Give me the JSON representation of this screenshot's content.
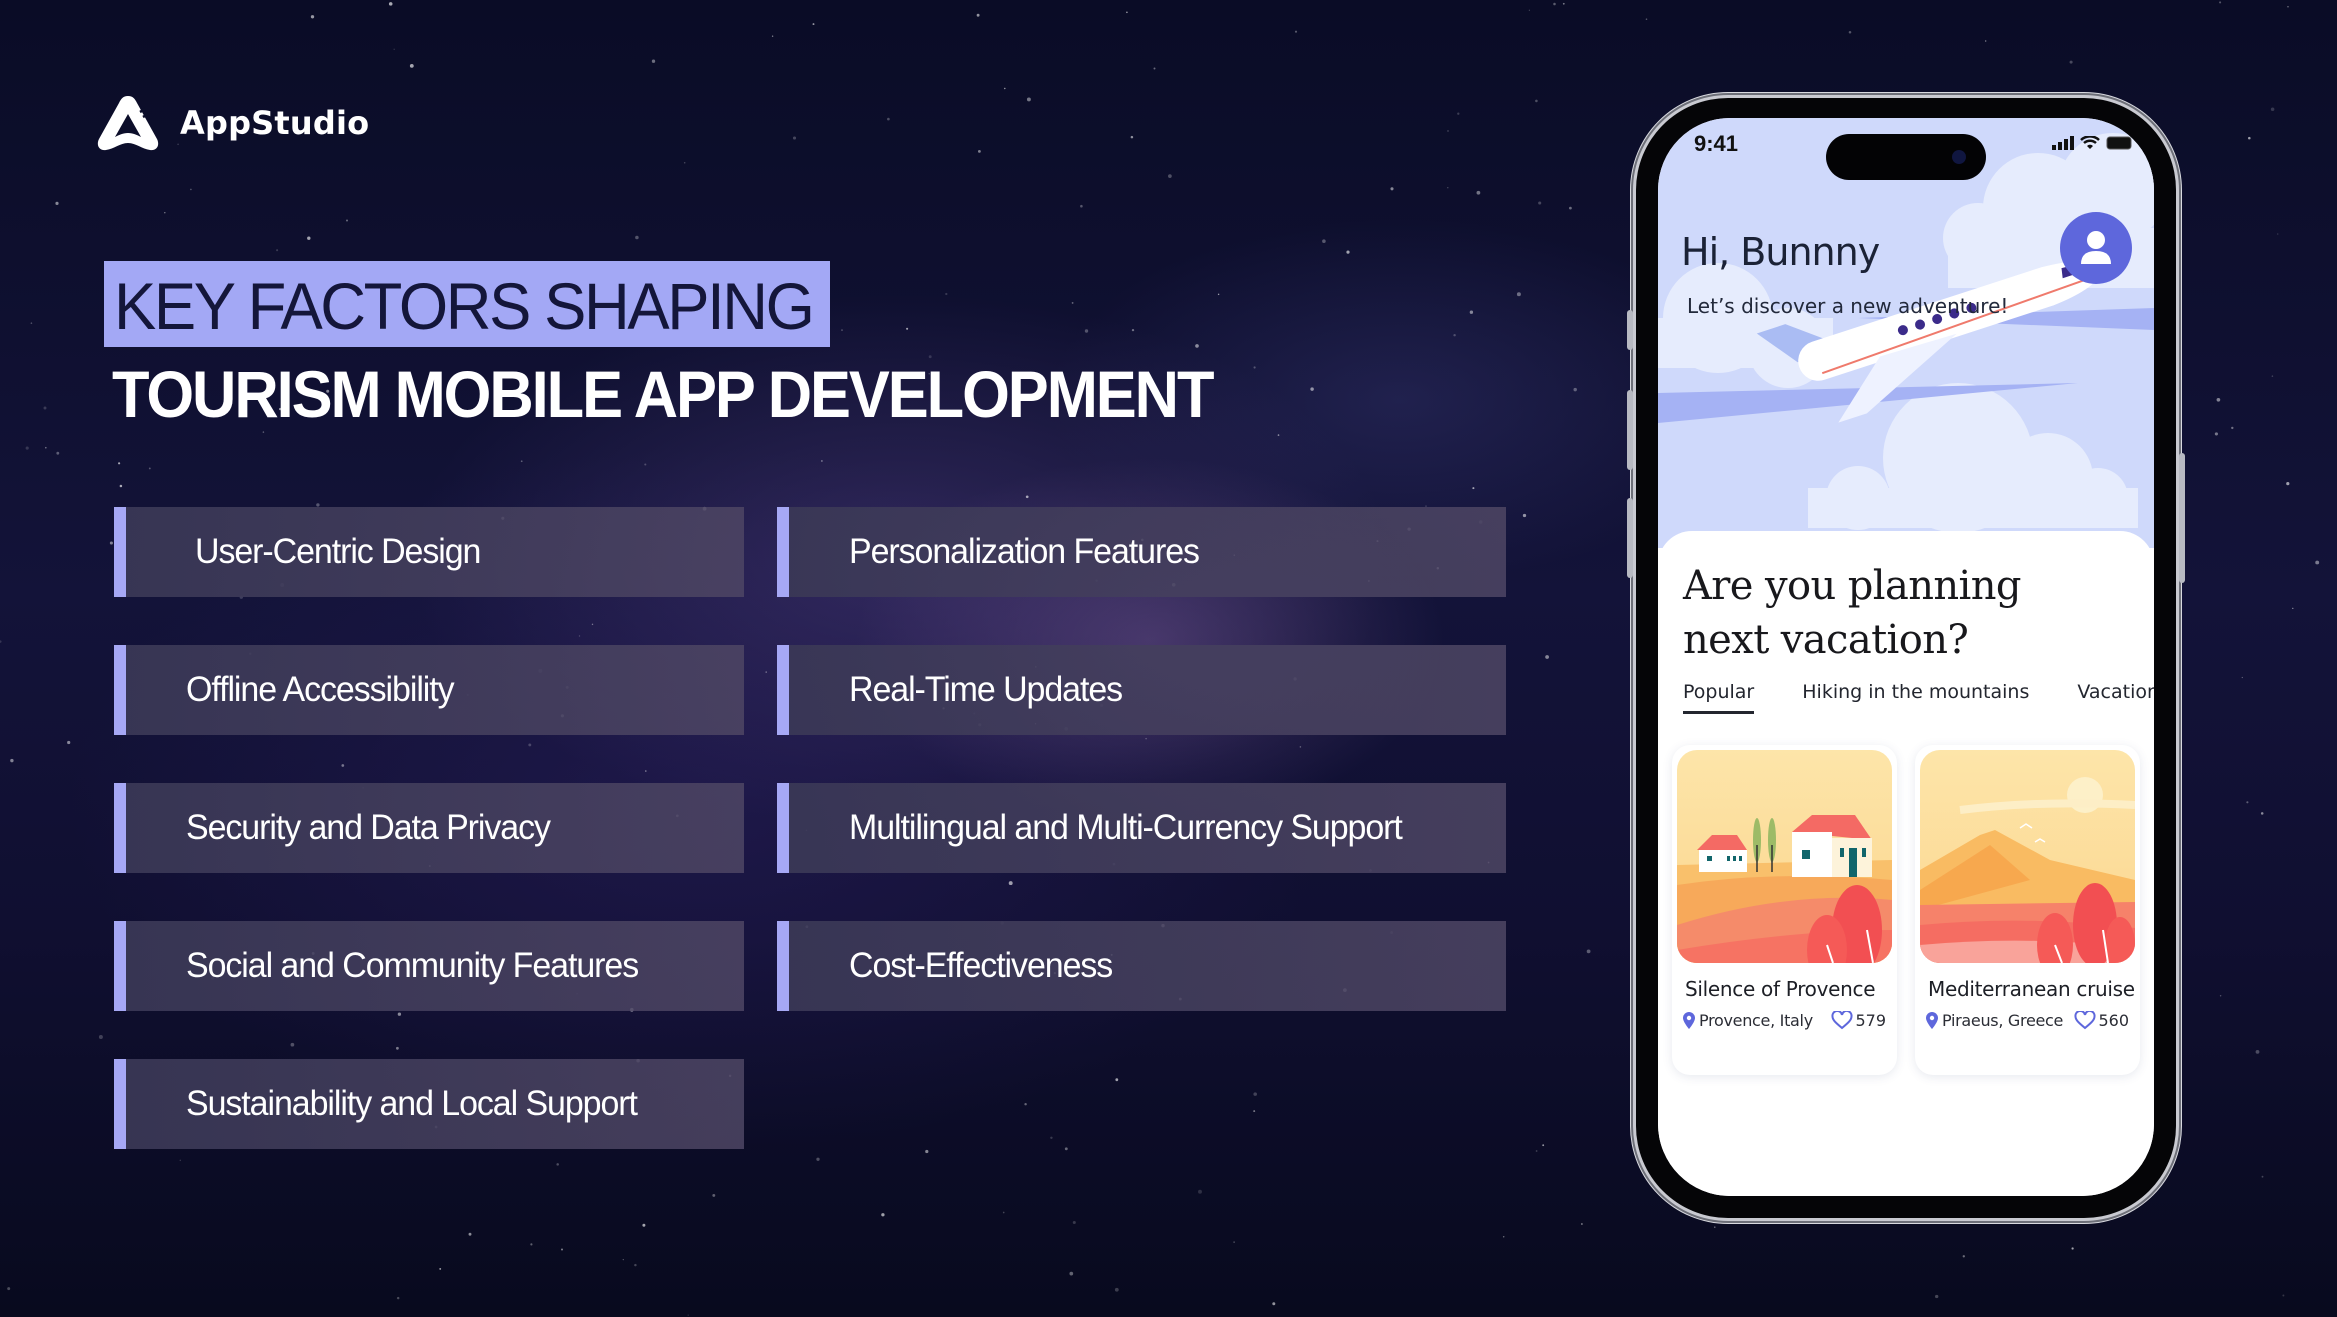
{
  "brand": {
    "name": "AppStudio",
    "logo_icon": "appstudio-a-logo-icon"
  },
  "title": {
    "highlighted_line": "KEY FACTORS SHAPING",
    "main_line": "TOURISM  MOBILE APP DEVELOPMENT"
  },
  "colors": {
    "accent": "#a6a8f5",
    "highlight": "#a3a8f5",
    "background": "#10112e",
    "card_bg": "#3d3a58",
    "app_primary": "#5e67dc"
  },
  "factors": {
    "left": [
      {
        "label": "User-Centric Design"
      },
      {
        "label": "Offline Accessibility"
      },
      {
        "label": "Security and Data Privacy"
      },
      {
        "label": "Social and Community Features"
      },
      {
        "label": "Sustainability and Local Support"
      }
    ],
    "right": [
      {
        "label": "Personalization Features"
      },
      {
        "label": "Real-Time Updates"
      },
      {
        "label": "Multilingual and Multi-Currency Support"
      },
      {
        "label": "Cost-Effectiveness"
      }
    ]
  },
  "phone": {
    "status_bar": {
      "time": "9:41",
      "icons": [
        "cellular-signal-icon",
        "wifi-icon",
        "battery-icon"
      ]
    },
    "greeting": "Hi, Bunnny",
    "subtitle": "Let’s discover a new adventure!",
    "avatar_icon": "user-profile-icon",
    "question": "Are you planning next vacation?",
    "tabs": [
      {
        "label": "Popular",
        "active": true
      },
      {
        "label": "Hiking in the mountains",
        "active": false
      },
      {
        "label": "Vacation at se",
        "active": false
      }
    ],
    "places": [
      {
        "title": "Silence of Provence",
        "location": "Provence, Italy",
        "likes": "579",
        "image": "provence-countryside-illustration"
      },
      {
        "title": "Mediterranean cruise",
        "location": "Piraeus, Greece",
        "likes": "560",
        "image": "mediterranean-coast-illustration"
      }
    ]
  }
}
